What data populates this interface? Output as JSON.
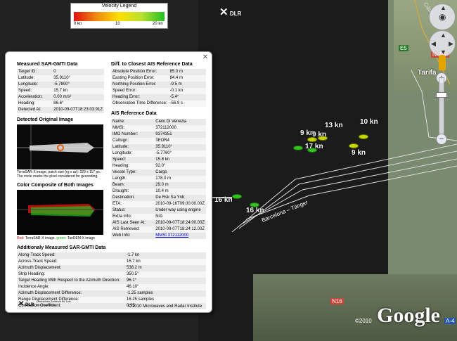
{
  "legend": {
    "title": "Velocity Legend",
    "ticks": [
      "0 kn",
      "10",
      "20 kn"
    ],
    "colors": [
      "#e01010",
      "#f08a10",
      "#ffe000",
      "#b8e030",
      "#20c020"
    ]
  },
  "map": {
    "dlr_label": "DLR",
    "town": "Tarifa",
    "roads": [
      "E5",
      "N-340",
      "A-4",
      "N16",
      "Cádiz"
    ],
    "route_label": "Barcelona – Tánger",
    "google": "Google",
    "copyright": "©2010"
  },
  "ships": [
    {
      "label": "9 kn",
      "color": "green"
    },
    {
      "label": "13 kn",
      "color": "yellow"
    },
    {
      "label": "10 kn",
      "color": "yellow"
    },
    {
      "label": "9 kn",
      "color": "green"
    },
    {
      "label": "17 kn",
      "color": "yellow"
    },
    {
      "label": "9 kn",
      "color": "yellow"
    },
    {
      "label": "16 kn",
      "color": "green"
    },
    {
      "label": "16 kn",
      "color": "green"
    }
  ],
  "panel": {
    "gmti": {
      "title": "Measured SAR-GMTI Data",
      "rows": [
        [
          "Target ID:",
          "0"
        ],
        [
          "Latitude:",
          "35.9110°"
        ],
        [
          "Longitude:",
          "-5.7800°"
        ],
        [
          "Speed:",
          "15.7 kn"
        ],
        [
          "Acceleration:",
          "0.00 m/s²"
        ],
        [
          "Heading:",
          "86.6°"
        ],
        [
          "Detected At:",
          "2010-09-07T18:23:03.91Z"
        ]
      ]
    },
    "diff": {
      "title": "Diff. to Closest AIS Reference Data",
      "rows": [
        [
          "Absolute Position Error:",
          "85.0 m"
        ],
        [
          "Easting Position Error:",
          "84.4 m"
        ],
        [
          "Northing Position Error:",
          "-9.5 m"
        ],
        [
          "Speed Error:",
          "-0.1 kn"
        ],
        [
          "Heading Error:",
          "-5.4°"
        ],
        [
          "Observation Time Difference:",
          "-56.9 s"
        ]
      ]
    },
    "detected": {
      "title": "Detected Original Image",
      "caption": "TerraSAR-X image, patch size (rg x az): 229 x 117 px. The circle marks the pixel considered for geocoding."
    },
    "composite": {
      "title": "Color Composite of Both Images",
      "caption_red": "Red:",
      "caption_mid": " TerraSAR-X image, ",
      "caption_green": "green:",
      "caption_end": " TanDEM-X image"
    },
    "ais": {
      "title": "AIS Reference Data",
      "rows": [
        [
          "Name:",
          "Cielo Di Venezia"
        ],
        [
          "MMSI:",
          "372112000"
        ],
        [
          "IMO Number:",
          "9374351"
        ],
        [
          "Callsign:",
          "3EOR4"
        ],
        [
          "Latitude:",
          "35.9110°"
        ],
        [
          "Longitude:",
          "-5.7760°"
        ],
        [
          "Speed:",
          "15.8 kn"
        ],
        [
          "Heading:",
          "92.0°"
        ],
        [
          "Vessel Type:",
          "Cargo"
        ],
        [
          "Length:",
          "178.0 m"
        ],
        [
          "Beam:",
          "29.0 m"
        ],
        [
          "Draught:",
          "10.4 m"
        ],
        [
          "Destination:",
          "De Rsk Sa Ynb"
        ],
        [
          "ETA:",
          "2010-09-16T09:00:00.00Z"
        ],
        [
          "Status:",
          "Under way using engine"
        ],
        [
          "Extra Info:",
          "N/A"
        ],
        [
          "AIS Last Seen At:",
          "2010-09-07T18:24:00.00Z"
        ],
        [
          "AIS Retrieved:",
          "2010-09-07T18:24:12.00Z"
        ]
      ],
      "web_key": "Web Info:",
      "web_link": "MMSI 372112000"
    },
    "additional": {
      "title": "Additionaly Measured SAR-GMTI Data",
      "rows": [
        [
          "Along-Track Speed:",
          "-1.7 kn"
        ],
        [
          "Across-Track Speed:",
          "15.7 kn"
        ],
        [
          "Azimuth Displacement:",
          "538.2 m"
        ],
        [
          "Strip Heading:",
          "350.5°"
        ],
        [
          "Target Heading With Respect to the Azimuth Direction:",
          "96.1°"
        ],
        [
          "Incidence Angle:",
          "46.10°"
        ],
        [
          "Azimuth Displacement Difference:",
          "-1.25 samples"
        ],
        [
          "Range Displacement Difference:",
          "16.25 samples"
        ],
        [
          "Correlation Coefficient:",
          "0.95"
        ]
      ]
    },
    "logo": "DLR",
    "logo_text": "Deutsches Zentrum für Luft- und Raumfahrt",
    "footer": "© 2010 Microwaves and Radar Institute"
  }
}
